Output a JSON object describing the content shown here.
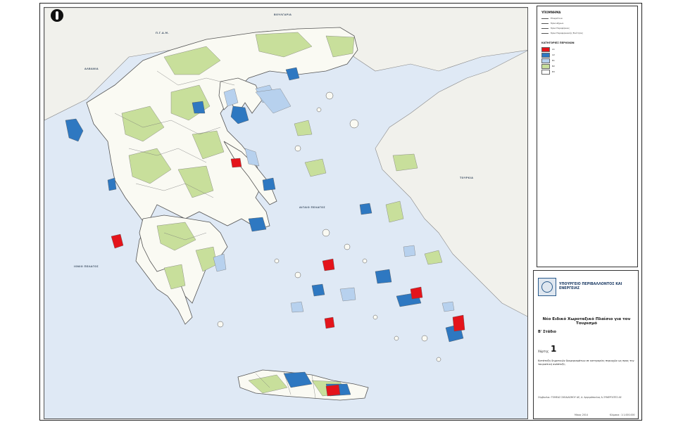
{
  "map": {
    "sea_labels": {
      "aegean": "ΑΙΓΑΙΟ ΠΕΛΑΓΟΣ",
      "ionian": "ΙΟΝΙΟ ΠΕΛΑΓΟΣ",
      "albania": "ΑΛΒΑΝΙΑ",
      "fyrom": "Π.Γ.Δ.Μ.",
      "bulgaria": "ΒΟΥΛΓΑΡΙΑ",
      "turkey": "ΤΟΥΡΚΙΑ"
    },
    "colors": {
      "land_outside": "#f1f1ec",
      "greece_land": "#fafaf3",
      "category_green": "#c8df9b",
      "category_blue": "#2e78c1",
      "category_lightblue": "#b7d1ee",
      "category_red": "#e4141b",
      "sea": "#dfe9f5",
      "boundary": "#555555"
    }
  },
  "legend": {
    "header_boundaries": "ΥΠΟΜΝΗΜΑ",
    "boundary_items": [
      "Επικράτεια",
      "Όρια Δήμων",
      "Όρια Περιφέρειας",
      "Όρια Περιφερειακής Ενότητας"
    ],
    "header_categories": "ΚΑΤΗΓΟΡΙΕΣ ΠΕΡΙΟΧΩΝ",
    "category_items": [
      {
        "label": "Α1",
        "color": "#e4141b"
      },
      {
        "label": "Α2",
        "color": "#2e78c1"
      },
      {
        "label": "Β1",
        "color": "#b7d1ee"
      },
      {
        "label": "Β2",
        "color": "#c8df9b"
      },
      {
        "label": "Β3",
        "color": "#ffffff"
      }
    ]
  },
  "titlebox": {
    "ministry": "ΥΠΟΥΡΓΕΙΟ ΠΕΡΙΒΑΛΛΟΝΤΟΣ ΚΑΙ ΕΝΕΡΓΕΙΑΣ",
    "title": "Νέο Ειδικό Χωροταξικό Πλαίσιο για τον Τουρισμό",
    "stage": "Β' Στάδιο",
    "map_label": "Χάρτης",
    "map_number": "1",
    "description": "Κατάταξη δημοτικών διαμερισμάτων σε κατηγορίες περιοχών ως προς την τουριστική ανάπτυξη",
    "credits": "Σύμβουλοι: ΤΟΜΕΑΣ ΣΧΕΔΙΑΣΜΟΥ ΑΕ, Α. Αργυρόπουλος & ΣΥΝΕΡΓΑΤΕΣ ΑΕ",
    "date": "Μάιος 2014",
    "scale": "Κλίμακα : 1:1.000.000"
  }
}
